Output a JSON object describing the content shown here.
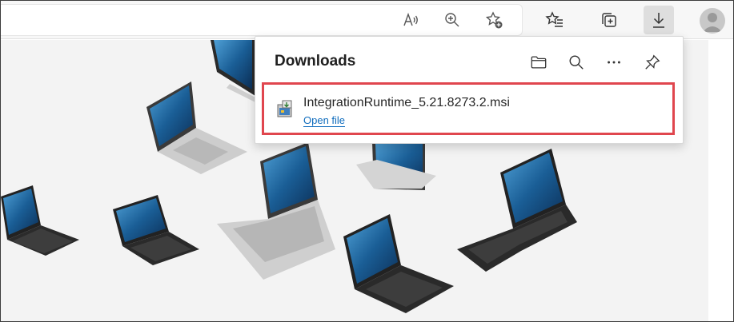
{
  "toolbar": {
    "icons": [
      "read-aloud-icon",
      "zoom-icon",
      "add-favorite-icon",
      "favorites-icon",
      "collections-icon",
      "downloads-icon",
      "profile-icon"
    ]
  },
  "downloads": {
    "title": "Downloads",
    "actions": [
      "open-folder-icon",
      "search-icon",
      "more-options-icon",
      "pin-icon"
    ],
    "item": {
      "file_name": "IntegrationRuntime_5.21.8273.2.msi",
      "action_label": "Open file"
    }
  },
  "colors": {
    "highlight_border": "#e0464e",
    "link": "#0f6cbd",
    "laptop_screen": "#1a5e96"
  }
}
